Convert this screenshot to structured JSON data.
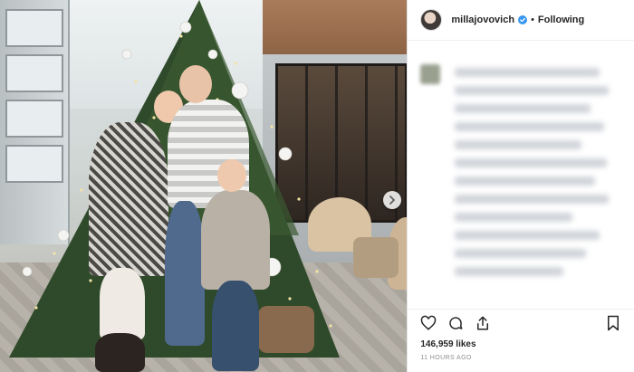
{
  "header": {
    "username": "millajovovich",
    "follow_state": "Following",
    "separator": "•"
  },
  "post": {
    "likes": "146,959 likes",
    "time_ago": "11 HOURS AGO"
  },
  "icons": {
    "verified": "verified-badge-icon",
    "like": "heart-icon",
    "comment": "comment-icon",
    "share": "share-icon",
    "save": "bookmark-icon",
    "next": "chevron-right-icon"
  },
  "colors": {
    "verified": "#3897f0",
    "text": "#262626",
    "muted": "#8e8e8e",
    "tree": "#2f4a2a"
  }
}
